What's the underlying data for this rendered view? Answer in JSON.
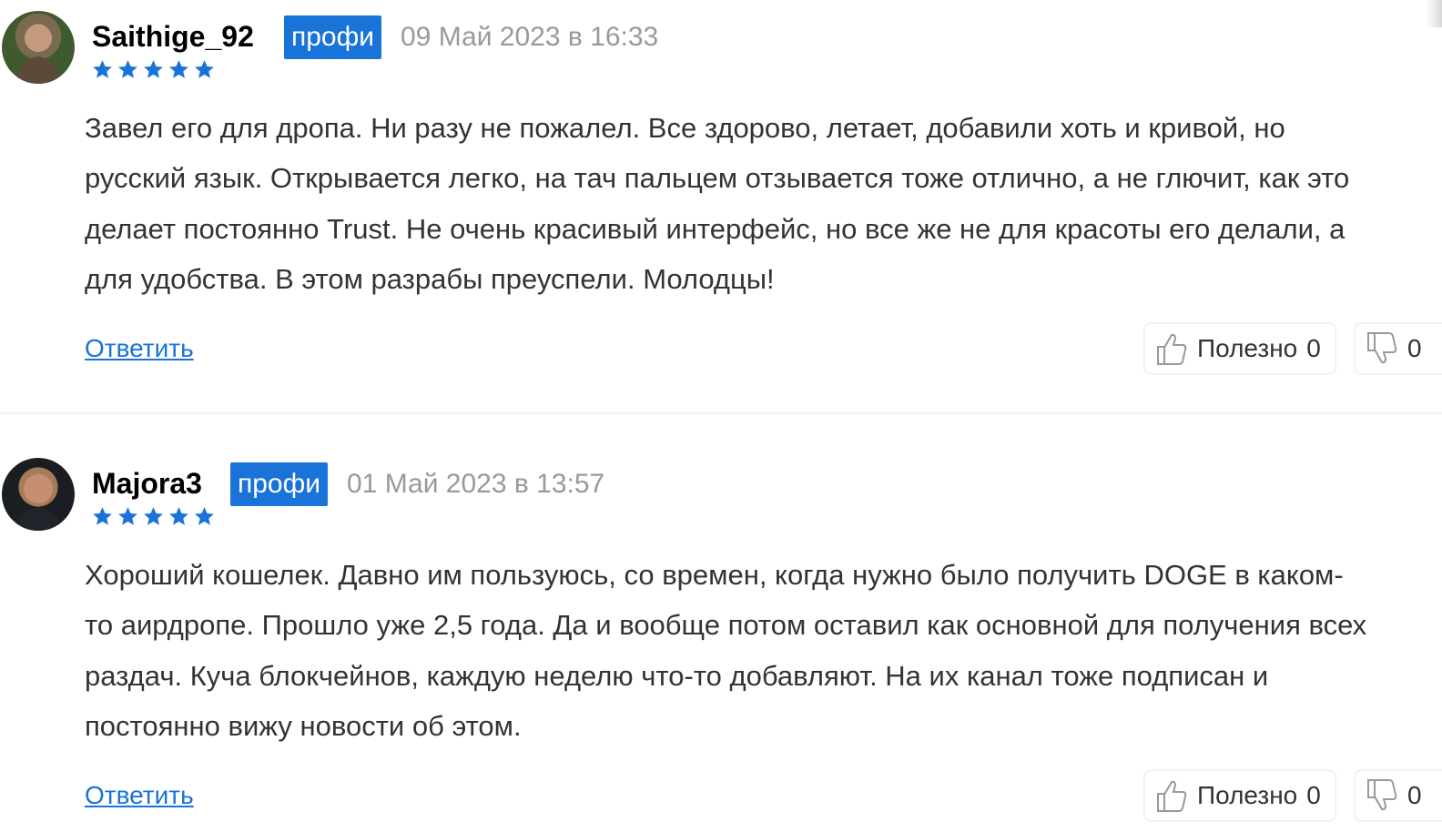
{
  "reviews": [
    {
      "username": "Saithige_92",
      "badge": "профи",
      "date": "09 Май 2023 в 16:33",
      "rating": 5,
      "text": "Завел его для дропа. Ни разу не пожалел. Все здорово, летает, добавили хоть и кривой, но\nрусский язык. Открывается легко, на тач пальцем отзывается тоже отлично, а не глючит, как это\nделает постоянно Trust. Не очень красивый интерфейс, но все же не для красоты его делали, а\nдля удобства. В этом разрабы преуспели. Молодцы!",
      "reply_label": "Ответить",
      "useful_label": "Полезно",
      "useful_count": "0",
      "not_useful_count": "0"
    },
    {
      "username": "Majora3",
      "badge": "профи",
      "date": "01 Май 2023 в 13:57",
      "rating": 5,
      "text": "Хороший кошелек. Давно им пользуюсь, со времен, когда нужно было получить DOGE в каком-\nто аирдропе. Прошло уже 2,5 года. Да и вообще потом оставил как основной для получения всех\nраздач. Куча блокчейнов, каждую неделю что-то добавляют. На их канал тоже подписан и\nпостоянно вижу новости об этом.",
      "reply_label": "Ответить",
      "useful_label": "Полезно",
      "useful_count": "0",
      "not_useful_count": "0"
    }
  ],
  "colors": {
    "accent": "#1a73d9",
    "date": "#999999",
    "text": "#333333",
    "star": "#1a73d9"
  },
  "icons": [
    "star-icon",
    "thumbs-up-icon",
    "thumbs-down-icon"
  ]
}
